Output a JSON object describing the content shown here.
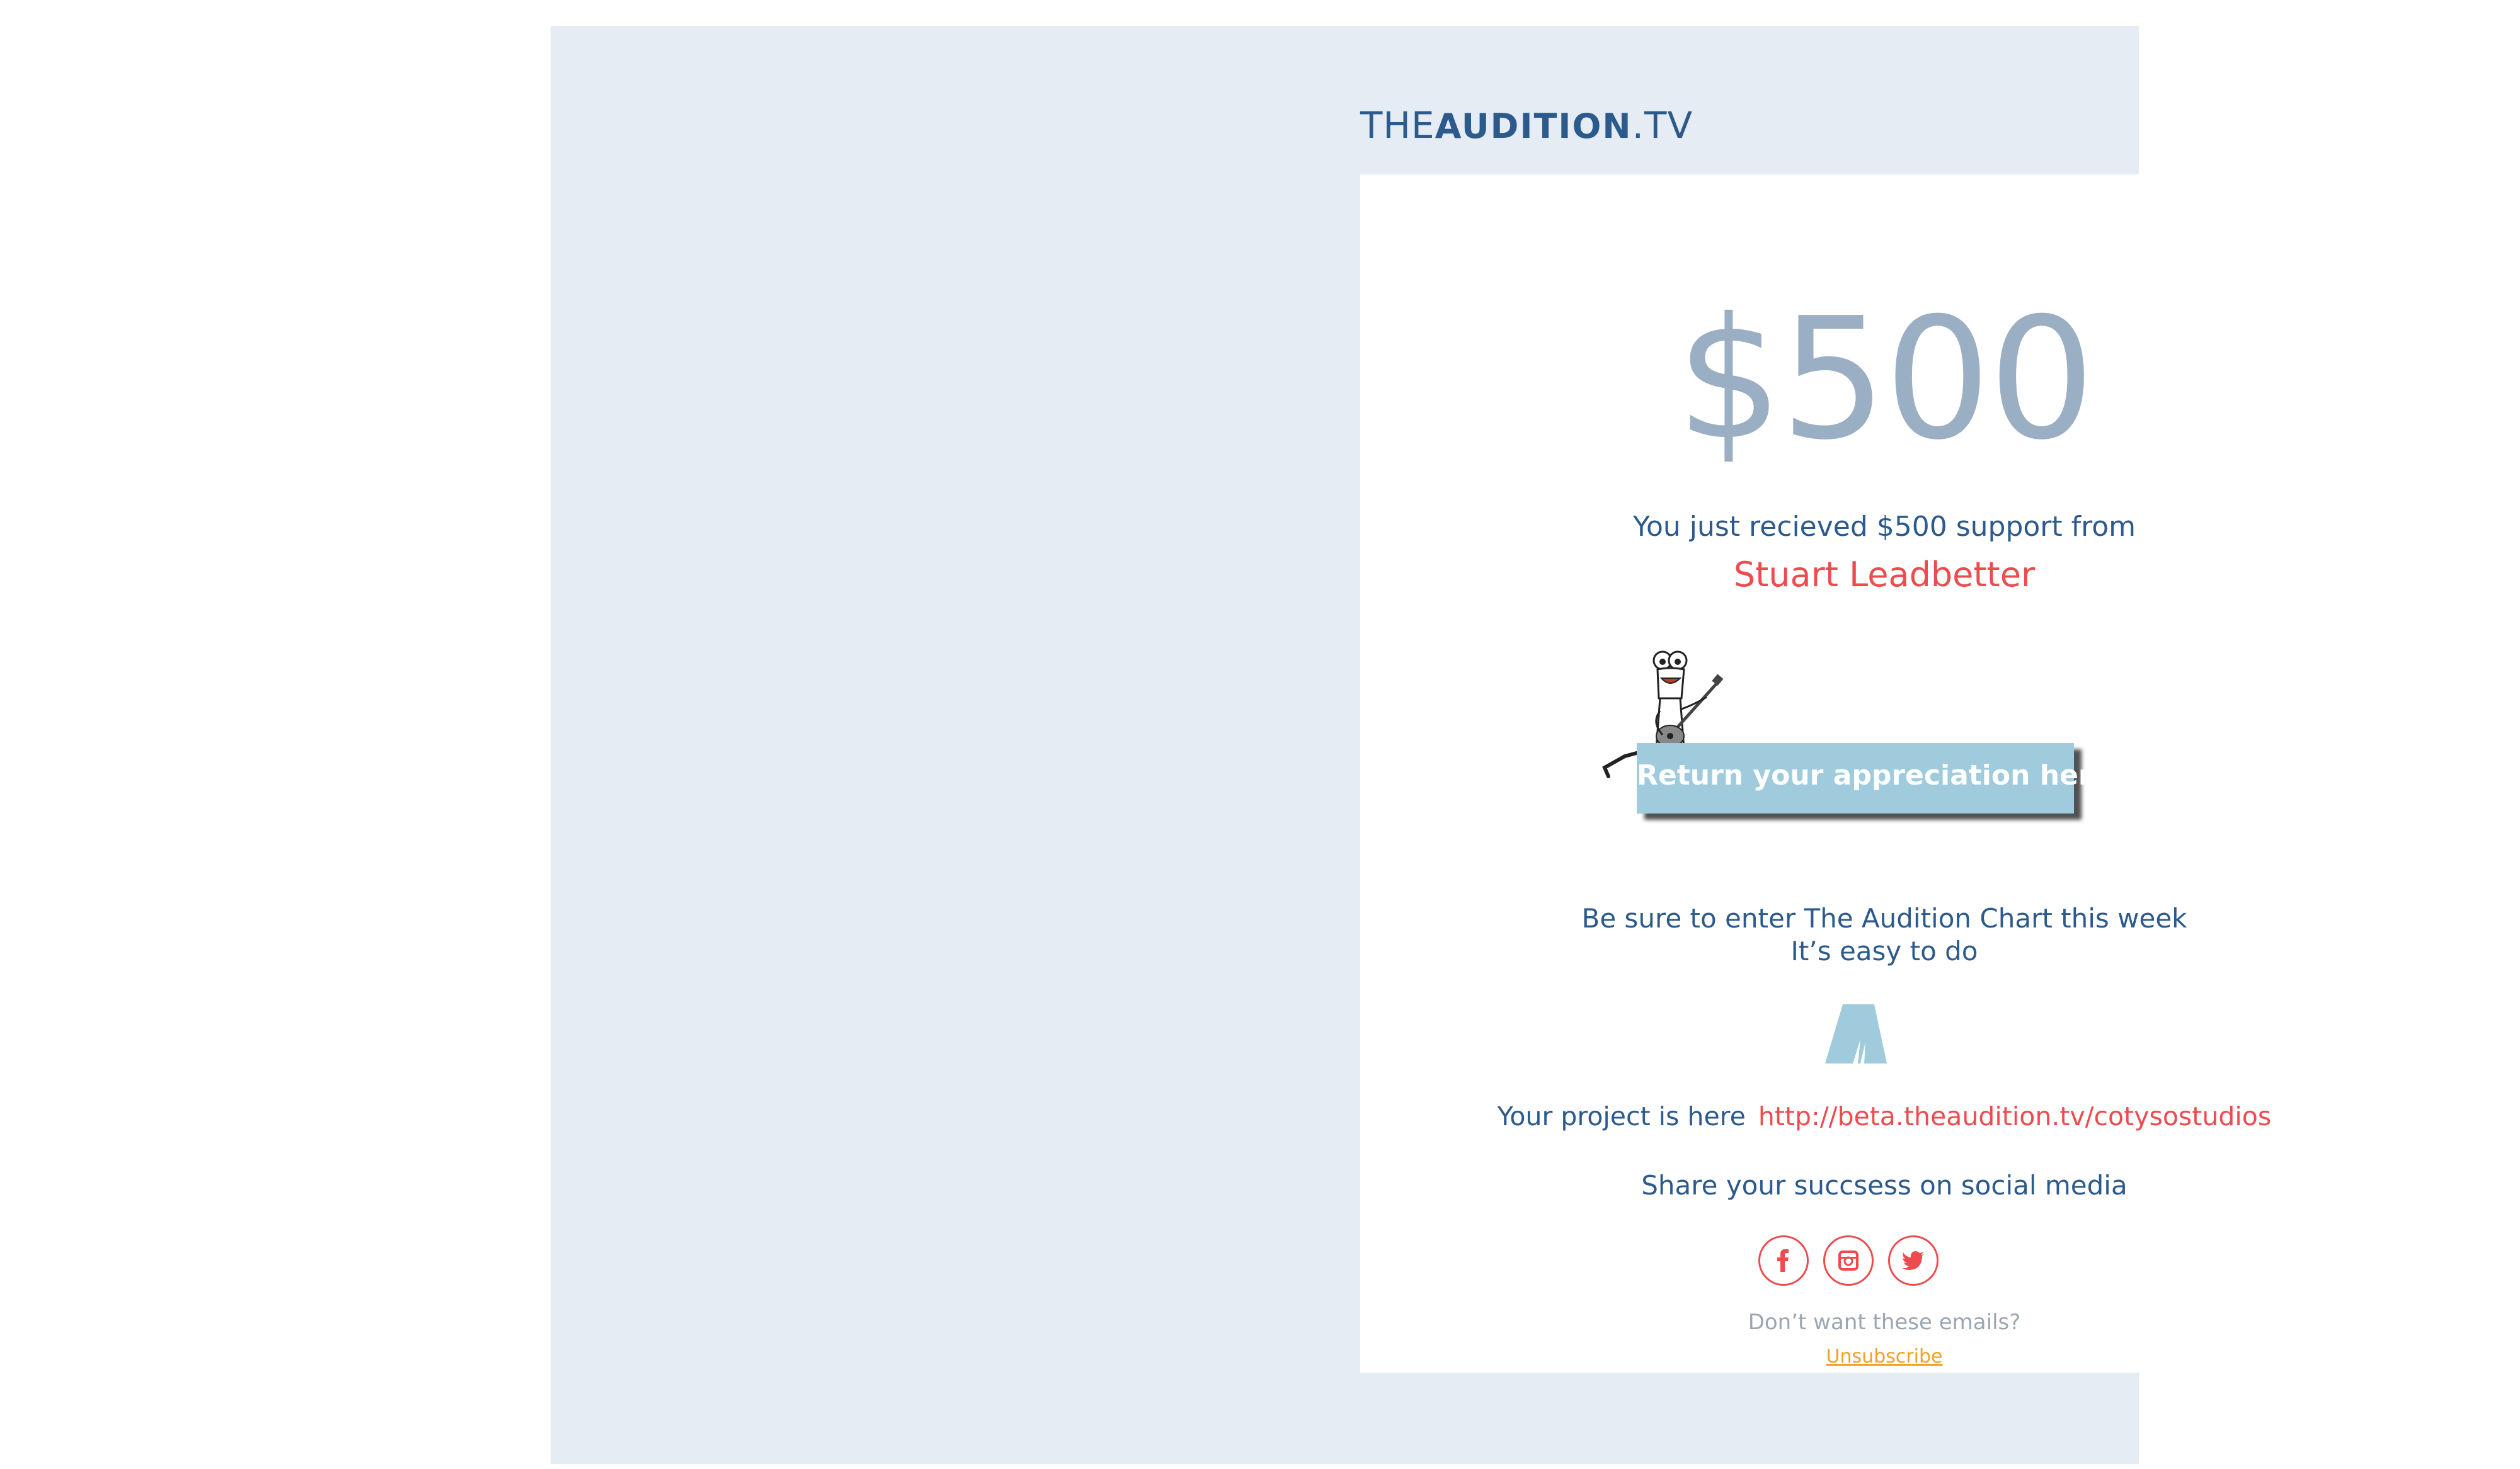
{
  "brand": {
    "logo_prefix": "THE",
    "logo_main": "AUDITION",
    "logo_suffix": ".TV"
  },
  "email": {
    "amount": "$500",
    "received_text": "You just recieved $500 support from",
    "sender_name": "Stuart Leadbetter",
    "cta_label": "Return your appreciation here",
    "chart_line1": "Be sure to enter The Audition Chart this week",
    "chart_line2": "It’s easy to do",
    "project_label": "Your project is here",
    "project_url": "http://beta.theaudition.tv/cotysostudios",
    "share_text": "Share your succsess on social media",
    "unsubscribe_prompt": "Don’t want these emails?",
    "unsubscribe_label": "Unsubscribe"
  },
  "social": [
    "facebook-icon",
    "instagram-icon",
    "twitter-icon"
  ],
  "colors": {
    "outer_bg": "#e5ecf4",
    "brand_blue": "#2c5a8c",
    "amount_grey": "#9aaec4",
    "accent_red": "#ee4b4f",
    "cta_blue": "#9fcbdc",
    "unsubscribe_orange": "#f2a027"
  }
}
